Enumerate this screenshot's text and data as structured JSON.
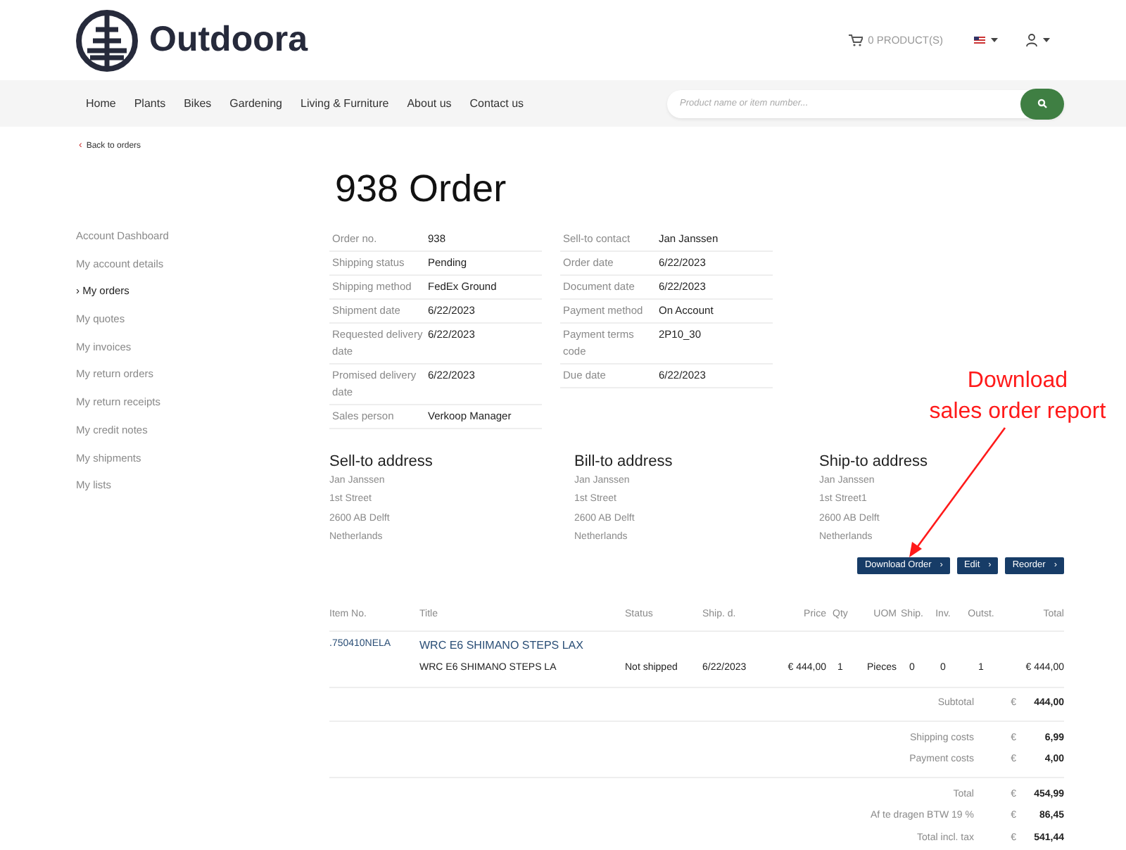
{
  "header": {
    "logo_text": "Outdoora",
    "cart_label": "0 PRODUCT(S)"
  },
  "nav": {
    "items": [
      {
        "label": "Home"
      },
      {
        "label": "Plants"
      },
      {
        "label": "Bikes"
      },
      {
        "label": "Gardening"
      },
      {
        "label": "Living & Furniture"
      },
      {
        "label": "About us"
      },
      {
        "label": "Contact us"
      }
    ],
    "search": {
      "placeholder": "Product name or item number..."
    }
  },
  "back_link": {
    "arrow": "‹",
    "label": "Back to orders"
  },
  "sidebar": {
    "selected_marker": "›",
    "items": [
      {
        "label": "Account Dashboard",
        "selected": false
      },
      {
        "label": "My account details",
        "selected": false
      },
      {
        "label": "My orders",
        "selected": true
      },
      {
        "label": "My quotes",
        "selected": false
      },
      {
        "label": "My invoices",
        "selected": false
      },
      {
        "label": "My return orders",
        "selected": false
      },
      {
        "label": "My return receipts",
        "selected": false
      },
      {
        "label": "My credit notes",
        "selected": false
      },
      {
        "label": "My shipments",
        "selected": false
      },
      {
        "label": "My lists",
        "selected": false
      }
    ]
  },
  "order": {
    "title": "938 Order",
    "details_left": [
      {
        "label": "Order no.",
        "value": "938"
      },
      {
        "label": "Shipping status",
        "value": "Pending"
      },
      {
        "label": "Shipping method",
        "value": "FedEx Ground"
      },
      {
        "label": "Shipment date",
        "value": "6/22/2023"
      },
      {
        "label": "Requested delivery date",
        "value": "6/22/2023"
      },
      {
        "label": "Promised delivery date",
        "value": "6/22/2023"
      },
      {
        "label": "Sales person",
        "value": "Verkoop Manager"
      }
    ],
    "details_right": [
      {
        "label": "Sell-to contact",
        "value": "Jan Janssen"
      },
      {
        "label": "Order date",
        "value": "6/22/2023"
      },
      {
        "label": "Document date",
        "value": "6/22/2023"
      },
      {
        "label": "Payment method",
        "value": "On Account"
      },
      {
        "label": "Payment terms code",
        "value": "2P10_30"
      },
      {
        "label": "Due date",
        "value": "6/22/2023"
      }
    ]
  },
  "addresses": [
    {
      "title": "Sell-to address",
      "lines": [
        "Jan Janssen",
        "1st Street",
        "2600 AB Delft",
        "Netherlands"
      ]
    },
    {
      "title": "Bill-to address",
      "lines": [
        "Jan Janssen",
        "1st Street",
        "2600 AB Delft",
        "Netherlands"
      ]
    },
    {
      "title": "Ship-to address",
      "lines": [
        "Jan Janssen",
        "1st Street1",
        "2600 AB Delft",
        "Netherlands"
      ]
    }
  ],
  "actions": [
    {
      "label": "Download Order",
      "chevron": "›"
    },
    {
      "label": "Edit",
      "chevron": "›"
    },
    {
      "label": "Reorder",
      "chevron": "›"
    }
  ],
  "lines_table": {
    "columns": [
      "Item No.",
      "Title",
      "Status",
      "Ship. d.",
      "Price",
      "Qty",
      "UOM",
      "Ship.",
      "Inv.",
      "Outst.",
      "Total"
    ],
    "rows": [
      {
        "item_no": ".750410NELA",
        "title": "WRC E6 SHIMANO STEPS LAX",
        "sublines": [
          [
            "WRC E6 SHIMANO STEPS LA",
            "Not shipped",
            "6/22/2023",
            "€ 444,00",
            "1",
            "Pieces",
            "0",
            "0",
            "1",
            "€ 444,00"
          ]
        ]
      }
    ]
  },
  "totals": [
    [
      {
        "label": "Subtotal",
        "currency": "€",
        "amount": "444,00"
      }
    ],
    [
      {
        "label": "Shipping costs",
        "currency": "€",
        "amount": "6,99"
      },
      {
        "label": "Payment costs",
        "currency": "€",
        "amount": "4,00"
      }
    ],
    [
      {
        "label": "Total",
        "currency": "€",
        "amount": "454,99"
      },
      {
        "label": "Af te dragen BTW 19 %",
        "currency": "€",
        "amount": "86,45"
      },
      {
        "label": "Total incl. tax",
        "currency": "€",
        "amount": "541,44"
      }
    ]
  ],
  "annotation": {
    "lines": [
      "Download",
      "sales order report"
    ]
  }
}
